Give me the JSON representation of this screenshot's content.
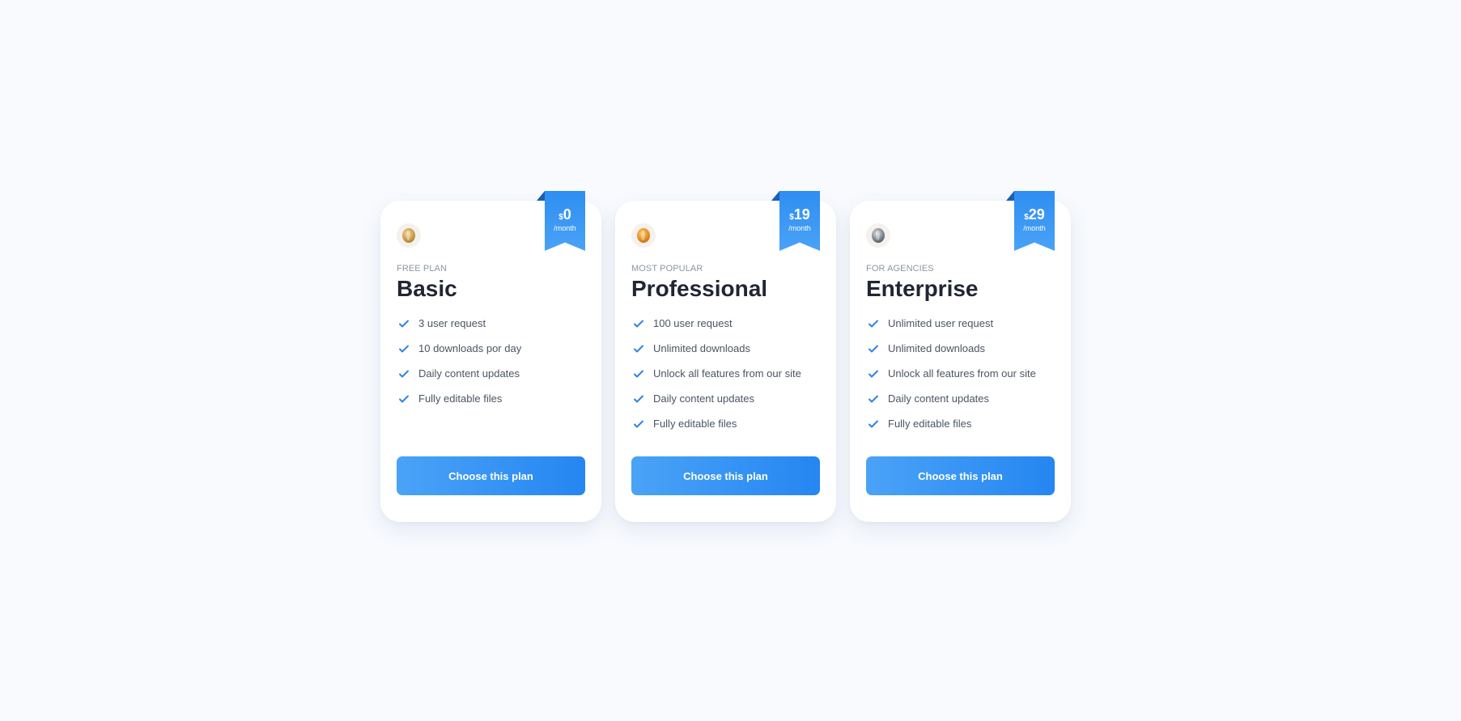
{
  "cards": [
    {
      "subtitle": "FREE PLAN",
      "title": "Basic",
      "price": "0",
      "currency": "$",
      "period": "/month",
      "features": [
        "3 user request",
        "10 downloads por day",
        "Daily content updates",
        "Fully editable files"
      ],
      "cta": "Choose this plan",
      "accent": "#2f90f1",
      "coin_color": "#c89a48"
    },
    {
      "subtitle": "MOST POPULAR",
      "title": "Professional",
      "price": "19",
      "currency": "$",
      "period": "/month",
      "features": [
        "100 user request",
        "Unlimited downloads",
        "Unlock all features from our site",
        "Daily content updates",
        "Fully editable files"
      ],
      "cta": "Choose this plan",
      "accent": "#2f90f1",
      "coin_color": "#e28b22"
    },
    {
      "subtitle": "FOR AGENCIES",
      "title": "Enterprise",
      "price": "29",
      "currency": "$",
      "period": "/month",
      "features": [
        "Unlimited user request",
        "Unlimited downloads",
        "Unlock all features from our site",
        "Daily content updates",
        "Fully editable files"
      ],
      "cta": "Choose this plan",
      "accent": "#2f90f1",
      "coin_color": "#79818a"
    }
  ],
  "icons": {
    "check": "check-icon"
  }
}
